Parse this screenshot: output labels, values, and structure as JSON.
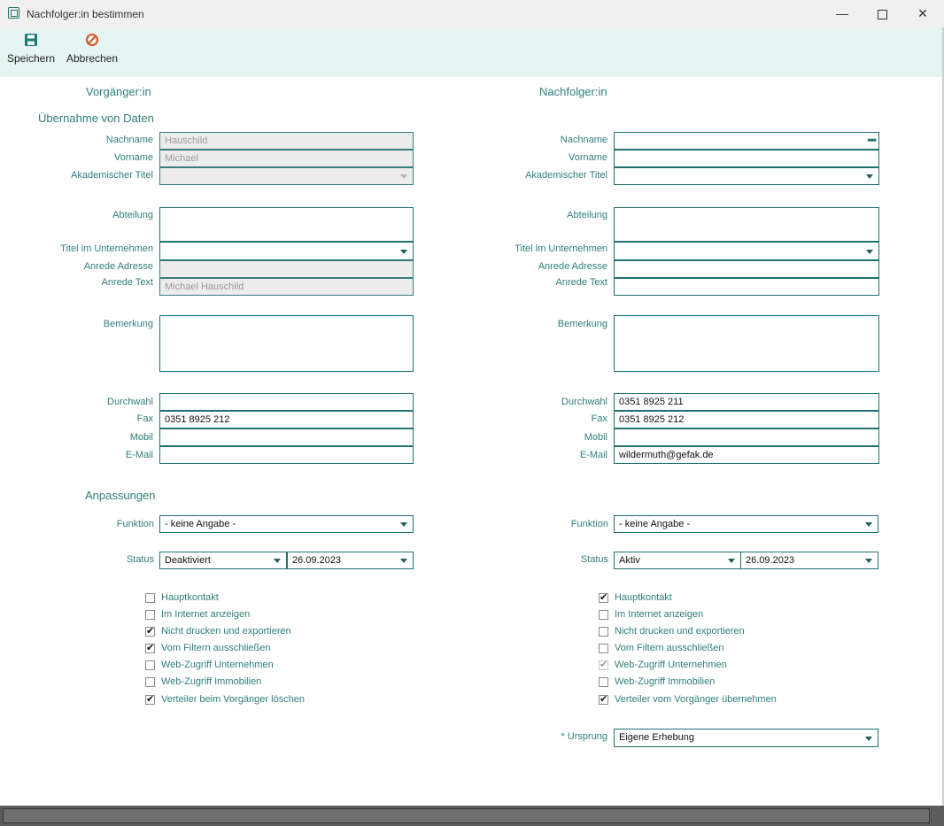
{
  "window": {
    "title": "Nachfolger:in bestimmen"
  },
  "toolbar": {
    "save_label": "Speichern",
    "cancel_label": "Abbrechen"
  },
  "colors": {
    "accent": "#2e7d7d",
    "toolbar_bg": "#e6f4f2",
    "save_icon": "#1f7a75",
    "cancel_icon": "#d9531e"
  },
  "icons": {
    "save": "floppy-disk-icon",
    "cancel": "no-entry-icon"
  },
  "left": {
    "heading": "Vorgänger:in",
    "section_data": "Übernahme von Daten",
    "labels": {
      "nachname": "Nachname",
      "vorname": "Vorname",
      "akad_titel": "Akademischer Titel",
      "abteilung": "Abteilung",
      "titel_unternehmen": "Titel im Unternehmen",
      "anrede_adresse": "Anrede Adresse",
      "anrede_text": "Anrede Text",
      "bemerkung": "Bemerkung",
      "durchwahl": "Durchwahl",
      "fax": "Fax",
      "mobil": "Mobil",
      "email": "E-Mail"
    },
    "values": {
      "nachname": "Hauschild",
      "vorname": "Michael",
      "akad_titel": "",
      "abteilung": "",
      "titel_unternehmen": "",
      "anrede_adresse": "",
      "anrede_text": "Michael Hauschild",
      "bemerkung": "",
      "durchwahl": "",
      "fax": "0351 8925 212",
      "mobil": "",
      "email": ""
    },
    "section_adjust": "Anpassungen",
    "funktion_label": "Funktion",
    "funktion_value": "- keine Angabe -",
    "status_label": "Status",
    "status_value": "Deaktiviert",
    "status_date": "26.09.2023",
    "checkboxes": [
      {
        "label": "Hauptkontakt",
        "checked": false
      },
      {
        "label": "Im Internet anzeigen",
        "checked": false
      },
      {
        "label": "Nicht drucken und exportieren",
        "checked": true
      },
      {
        "label": "Vom Filtern ausschließen",
        "checked": true
      },
      {
        "label": "Web-Zugriff Unternehmen",
        "checked": false
      },
      {
        "label": "Web-Zugriff Immobilien",
        "checked": false
      },
      {
        "label": "Verteiler beim Vorgänger löschen",
        "checked": true
      }
    ]
  },
  "right": {
    "heading": "Nachfolger:in",
    "labels": {
      "nachname": "Nachname",
      "vorname": "Vorname",
      "akad_titel": "Akademischer Titel",
      "abteilung": "Abteilung",
      "titel_unternehmen": "Titel im Unternehmen",
      "anrede_adresse": "Anrede Adresse",
      "anrede_text": "Anrede Text",
      "bemerkung": "Bemerkung",
      "durchwahl": "Durchwahl",
      "fax": "Fax",
      "mobil": "Mobil",
      "email": "E-Mail"
    },
    "values": {
      "nachname": "",
      "vorname": "",
      "akad_titel": "",
      "abteilung": "",
      "titel_unternehmen": "",
      "anrede_adresse": "",
      "anrede_text": "",
      "bemerkung": "",
      "durchwahl": "0351 8925 211",
      "fax": "0351 8925 212",
      "mobil": "",
      "email": "wildermuth@gefak.de"
    },
    "lookup_button": "•••",
    "funktion_label": "Funktion",
    "funktion_value": "- keine Angabe -",
    "status_label": "Status",
    "status_value": "Aktiv",
    "status_date": "26.09.2023",
    "checkboxes": [
      {
        "label": "Hauptkontakt",
        "checked": true
      },
      {
        "label": "Im Internet anzeigen",
        "checked": false
      },
      {
        "label": "Nicht drucken und exportieren",
        "checked": false
      },
      {
        "label": "Vom Filtern ausschließen",
        "checked": false
      },
      {
        "label": "Web-Zugriff Unternehmen",
        "checked": true,
        "disabled": true
      },
      {
        "label": "Web-Zugriff Immobilien",
        "checked": false
      },
      {
        "label": "Verteiler vom Vorgänger übernehmen",
        "checked": true
      }
    ],
    "ursprung_label": "* Ursprung",
    "ursprung_value": "Eigene Erhebung"
  }
}
